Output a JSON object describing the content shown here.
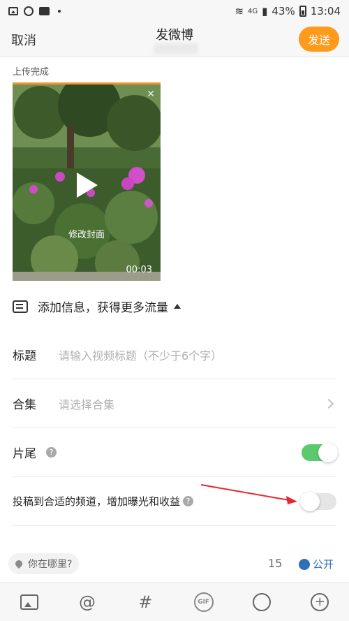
{
  "status_bar": {
    "signal_text": "4G",
    "battery": "43%",
    "time": "13:04"
  },
  "header": {
    "cancel_label": "取消",
    "title": "发微博",
    "send_label": "发送"
  },
  "upload": {
    "status_label": "上传完成",
    "cover_label": "修改封面",
    "duration": "00:03"
  },
  "info": {
    "add_info_label": "添加信息，获得更多流量"
  },
  "form": {
    "title_label": "标题",
    "title_placeholder": "请输入视频标题（不少于6个字）",
    "collection_label": "合集",
    "collection_placeholder": "请选择合集",
    "ending_label": "片尾",
    "ending_enabled": true,
    "channel_label": "投稿到合适的频道，增加曝光和收益",
    "channel_enabled": false
  },
  "footer": {
    "location_placeholder": "你在哪里?",
    "count": "15",
    "visibility": "公开"
  },
  "toolbar": {
    "gif_label": "GIF",
    "mention_label": "@",
    "hashtag_label": "#",
    "add_label": "+"
  },
  "colors": {
    "accent": "#ff9a1a",
    "toggle_on": "#5cc96d",
    "link_blue": "#2e6fb8"
  }
}
